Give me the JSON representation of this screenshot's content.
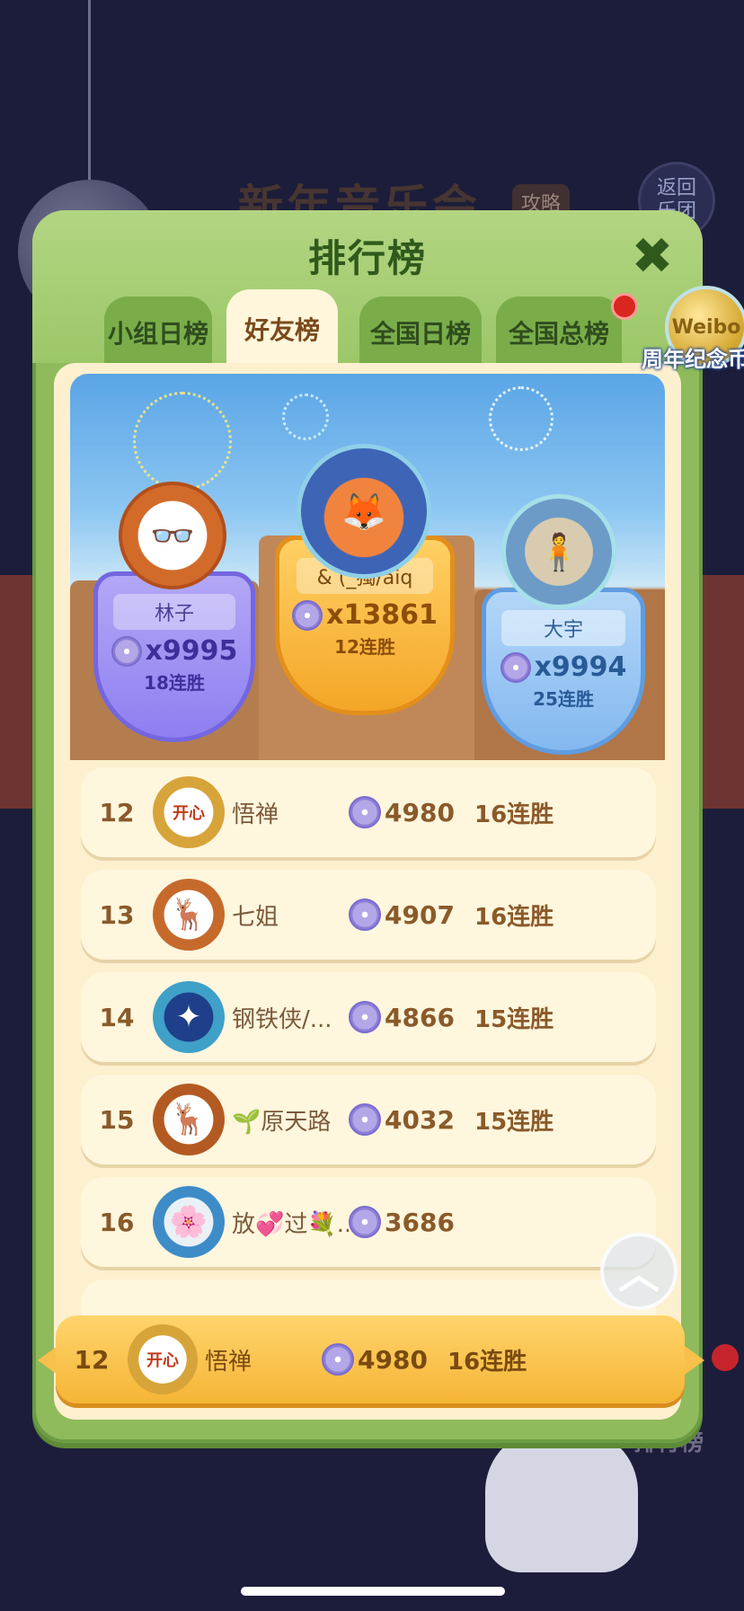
{
  "background": {
    "title": "新年音乐会",
    "tag": "攻略",
    "back_label": "返回\n乐团",
    "rank_label": "排行榜"
  },
  "panel": {
    "title": "排行榜",
    "close_label": "✖"
  },
  "tabs": [
    {
      "label": "小组日榜",
      "active": false
    },
    {
      "label": "好友榜",
      "active": true
    },
    {
      "label": "全国日榜",
      "active": false
    },
    {
      "label": "全国总榜",
      "active": false,
      "has_dot": true
    }
  ],
  "anniversary_coin": {
    "label": "周年纪念币",
    "badge_text": "Weibo"
  },
  "podium": {
    "first": {
      "name": "& (_獨/aiq",
      "score": "x13861",
      "streak": "12连胜"
    },
    "second": {
      "name": "林子",
      "score": "x9995",
      "streak": "18连胜"
    },
    "third": {
      "name": "大宇",
      "score": "x9994",
      "streak": "25连胜"
    }
  },
  "rows": [
    {
      "rank": "12",
      "name": "悟禅",
      "score": "4980",
      "streak": "16连胜",
      "avatar": "开心",
      "avatar_bg": "#d7a43a"
    },
    {
      "rank": "13",
      "name": "七姐",
      "score": "4907",
      "streak": "16连胜",
      "avatar": "🦌",
      "avatar_bg": "#c66a2c"
    },
    {
      "rank": "14",
      "name": "钢铁侠/...",
      "score": "4866",
      "streak": "15连胜",
      "avatar": "✦",
      "avatar_bg": "#2f5fa8"
    },
    {
      "rank": "15",
      "name": "🌱原天路",
      "score": "4032",
      "streak": "15连胜",
      "avatar": "🦌",
      "avatar_bg": "#b35a22"
    },
    {
      "rank": "16",
      "name": "放💞过💐...",
      "score": "3686",
      "streak": "",
      "avatar": "🌸",
      "avatar_bg": "#3d8cc8"
    }
  ],
  "my_row": {
    "rank": "12",
    "name": "悟禅",
    "score": "4980",
    "streak": "16连胜",
    "avatar": "开心"
  },
  "scroll_top_icon": "chevron-up-icon"
}
